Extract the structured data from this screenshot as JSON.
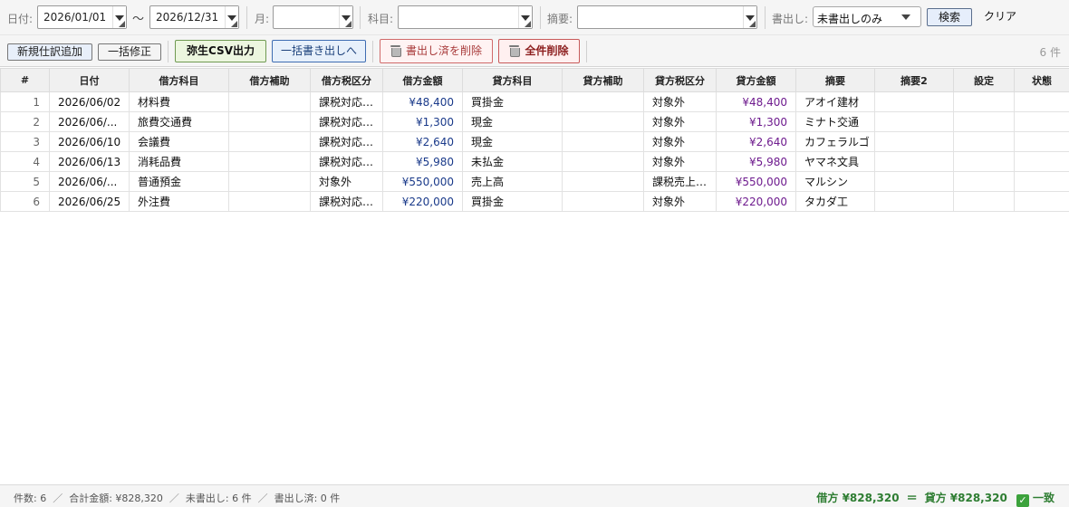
{
  "filter": {
    "date_label": "日付:",
    "date_from": "2026/01/01",
    "tilde": "～",
    "date_to": "2026/12/31",
    "month_label": "月:",
    "month_value": "",
    "account_label": "科目:",
    "account_value": "",
    "memo_label": "摘要:",
    "memo_value": "",
    "export_label": "書出し:",
    "export_value": "未書出しのみ",
    "search_label": "検索",
    "clear_label": "クリア"
  },
  "toolbar": {
    "new_entry": "新規仕訳追加",
    "bulk_edit": "一括修正",
    "csv_export": "弥生CSV出力",
    "bulk_export": "一括書き出しへ",
    "delete_exported": "書出し済を削除",
    "delete_all": "全件削除",
    "count": "6 件"
  },
  "grid": {
    "columns": [
      "#",
      "日付",
      "借方科目",
      "借方補助",
      "借方税区分",
      "借方金額",
      "貸方科目",
      "貸方補助",
      "貸方税区分",
      "貸方金額",
      "摘要",
      "摘要2",
      "設定",
      "状態"
    ],
    "rows": [
      [
        "1",
        "2026/06/02",
        "材料費",
        "",
        "課税対応…",
        "¥48,400",
        "買掛金",
        "",
        "対象外",
        "¥48,400",
        "アオイ建材",
        "",
        "",
        ""
      ],
      [
        "2",
        "2026/06/...",
        "旅費交通費",
        "",
        "課税対応…",
        "¥1,300",
        "現金",
        "",
        "対象外",
        "¥1,300",
        "ミナト交通",
        "",
        "",
        ""
      ],
      [
        "3",
        "2026/06/10",
        "会議費",
        "",
        "課税対応…",
        "¥2,640",
        "現金",
        "",
        "対象外",
        "¥2,640",
        "カフェラルゴ",
        "",
        "",
        ""
      ],
      [
        "4",
        "2026/06/13",
        "消耗品費",
        "",
        "課税対応…",
        "¥5,980",
        "未払金",
        "",
        "対象外",
        "¥5,980",
        "ヤマネ文具",
        "",
        "",
        ""
      ],
      [
        "5",
        "2026/06/...",
        "普通預金",
        "",
        "対象外",
        "¥550,000",
        "売上高",
        "",
        "課税売上…",
        "¥550,000",
        "マルシン",
        "",
        "",
        ""
      ],
      [
        "6",
        "2026/06/25",
        "外注費",
        "",
        "課税対応…",
        "¥220,000",
        "買掛金",
        "",
        "対象外",
        "¥220,000",
        "タカダ工",
        "",
        "",
        ""
      ]
    ]
  },
  "status": {
    "count": "件数: 6",
    "total": "合計金額: ¥828,320",
    "unexported": "未書出し: 6 件",
    "exported": "書出し済: 0 件",
    "separator": "／",
    "debit": "借方 ¥828,320",
    "equals": "＝",
    "credit": "貸方 ¥828,320",
    "check": "✓",
    "match": "一致"
  },
  "colors": {
    "debit_amount": "#1a3a8a",
    "credit_amount": "#6e1b8e",
    "balance_ok": "#2e7d32"
  }
}
